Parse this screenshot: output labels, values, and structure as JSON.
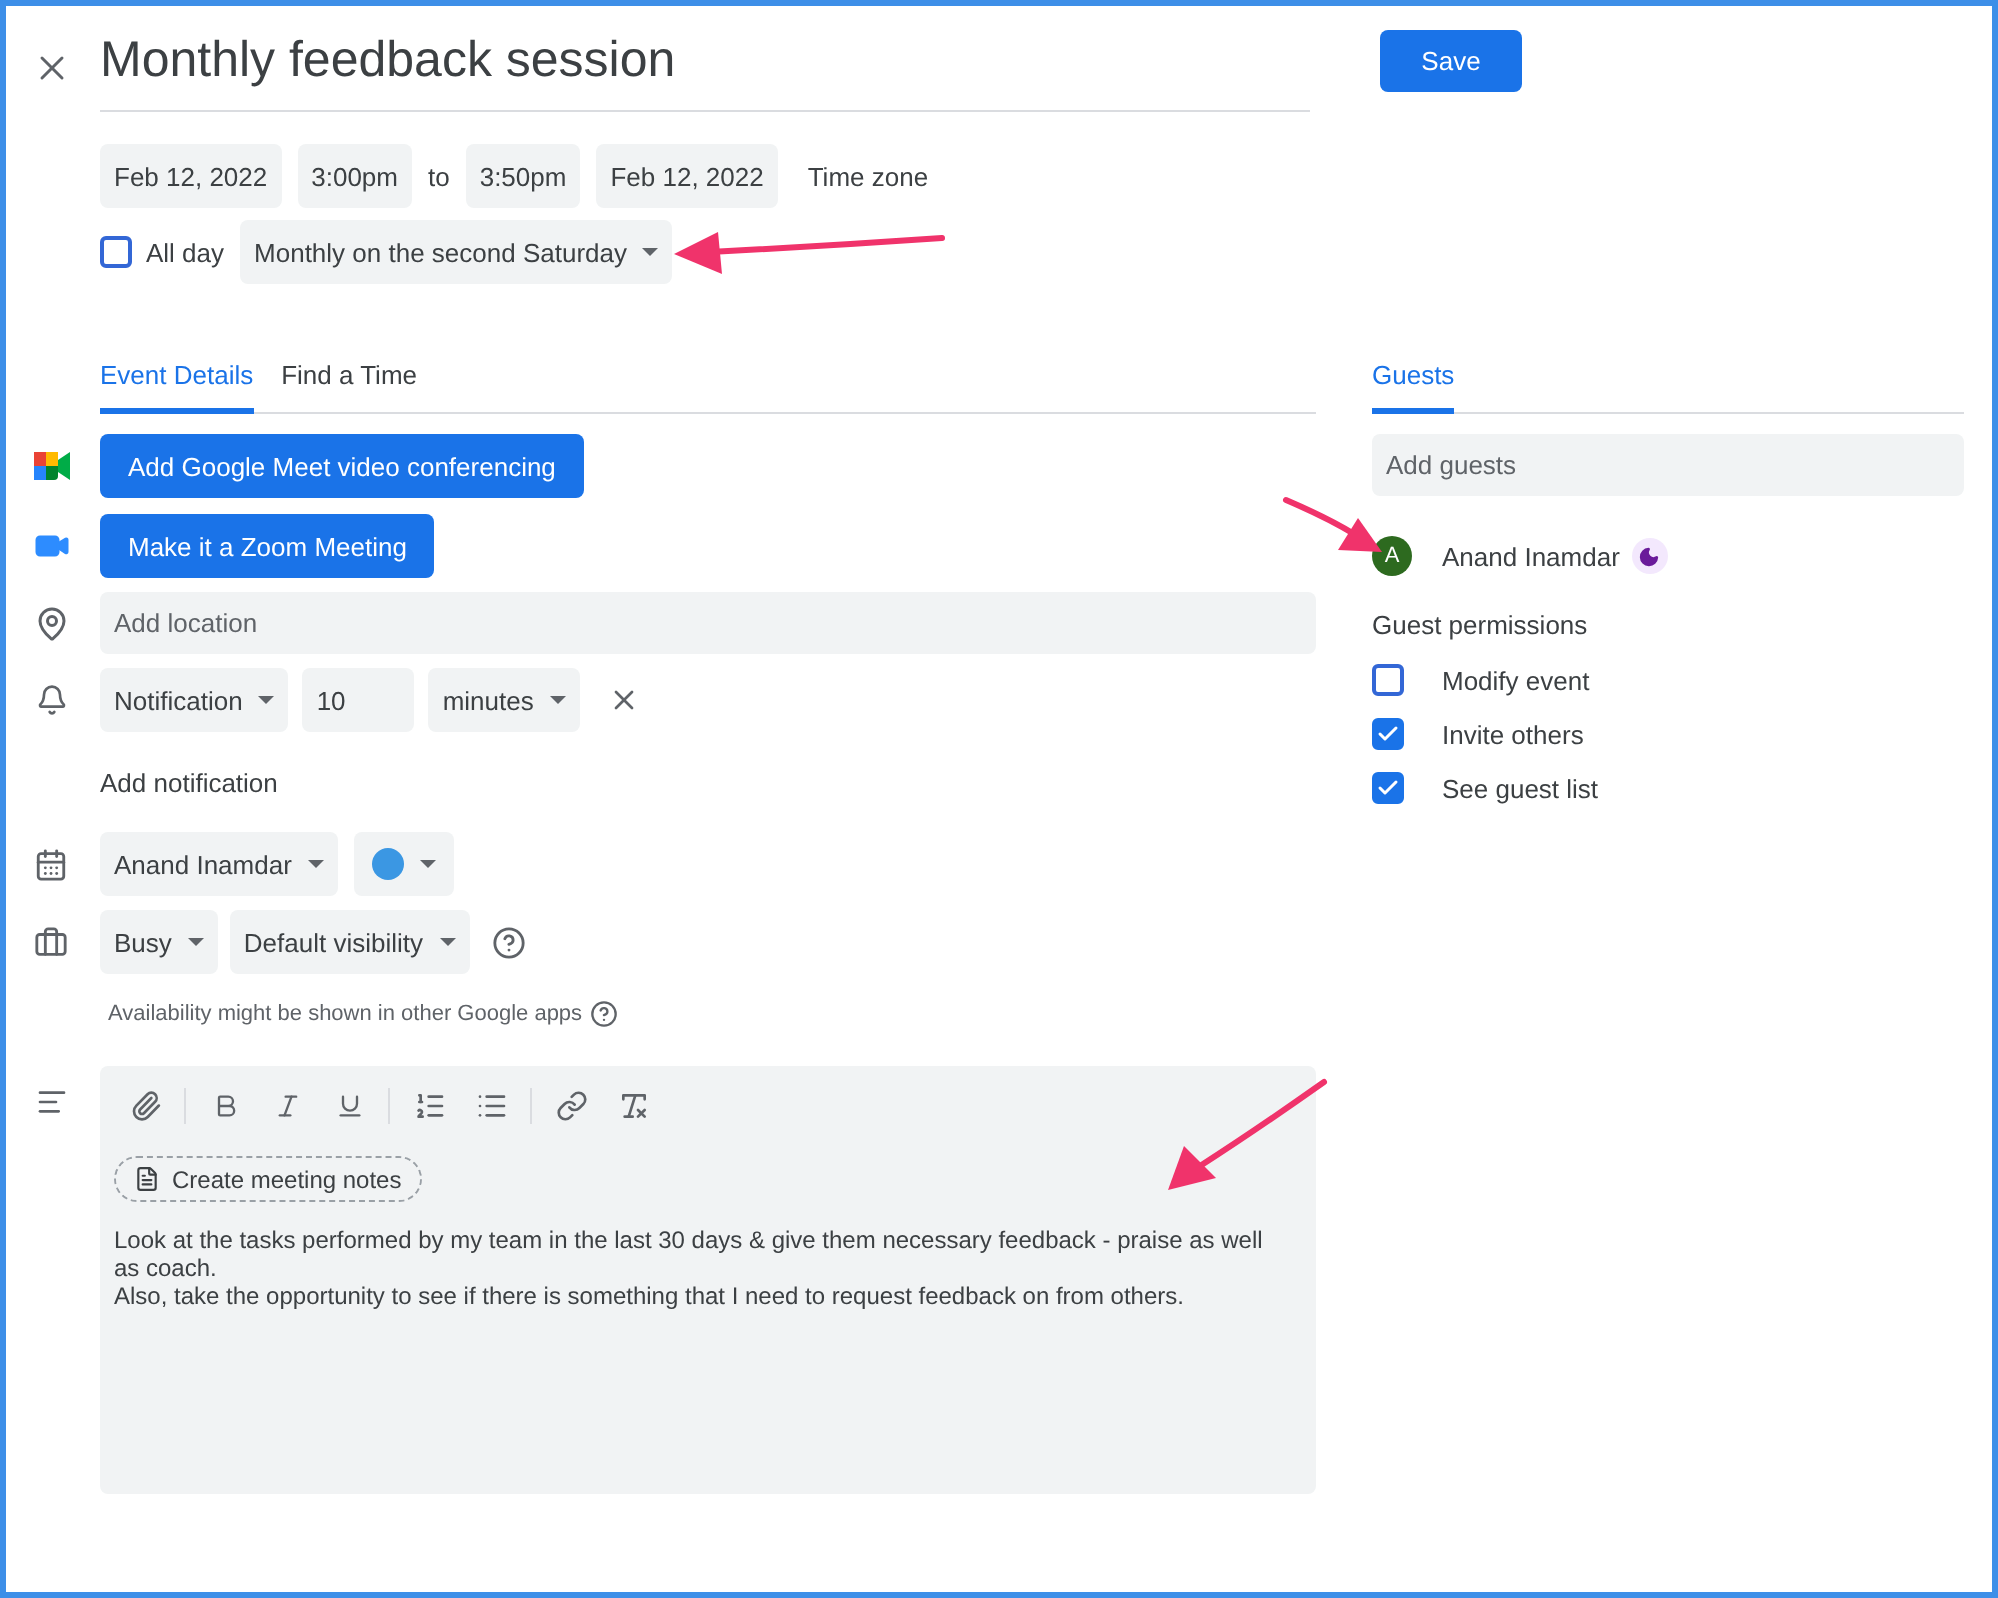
{
  "title": "Monthly feedback session",
  "save_button": "Save",
  "date_row": {
    "start_date": "Feb 12, 2022",
    "start_time": "3:00pm",
    "separator": "to",
    "end_time": "3:50pm",
    "end_date": "Feb 12, 2022",
    "time_zone": "Time zone"
  },
  "all_day": {
    "label": "All day",
    "checked": false
  },
  "recurrence": "Monthly on the second Saturday",
  "tabs": [
    {
      "label": "Event Details",
      "selected": true
    },
    {
      "label": "Find a Time",
      "selected": false
    }
  ],
  "conference_buttons": [
    {
      "kind": "meet",
      "label": "Add Google Meet video conferencing"
    },
    {
      "kind": "zoom",
      "label": "Make it a Zoom Meeting"
    }
  ],
  "location": {
    "placeholder": "Add location"
  },
  "notification": {
    "type": "Notification",
    "value": "10",
    "unit": "minutes"
  },
  "add_notification": "Add notification",
  "calendar": {
    "owner": "Anand Inamdar",
    "color": "#3b97e3"
  },
  "availability": {
    "status": "Busy",
    "visibility": "Default visibility",
    "note": "Availability might be shown in other Google apps"
  },
  "description": {
    "create_notes": "Create meeting notes",
    "lines": [
      "Look at the tasks performed by my team in the last 30 days & give them necessary feedback - praise as well as coach.",
      "Also, take the opportunity to see if there is something that I need to request feedback on from others."
    ]
  },
  "guests_tab": {
    "label": "Guests",
    "selected": true
  },
  "add_guests": {
    "placeholder": "Add guests"
  },
  "guests": [
    {
      "initial": "A",
      "name": "Anand Inamdar"
    }
  ],
  "guest_permissions": {
    "title": "Guest permissions",
    "options": [
      {
        "label": "Modify event",
        "checked": false
      },
      {
        "label": "Invite others",
        "checked": true
      },
      {
        "label": "See guest list",
        "checked": true
      }
    ]
  }
}
